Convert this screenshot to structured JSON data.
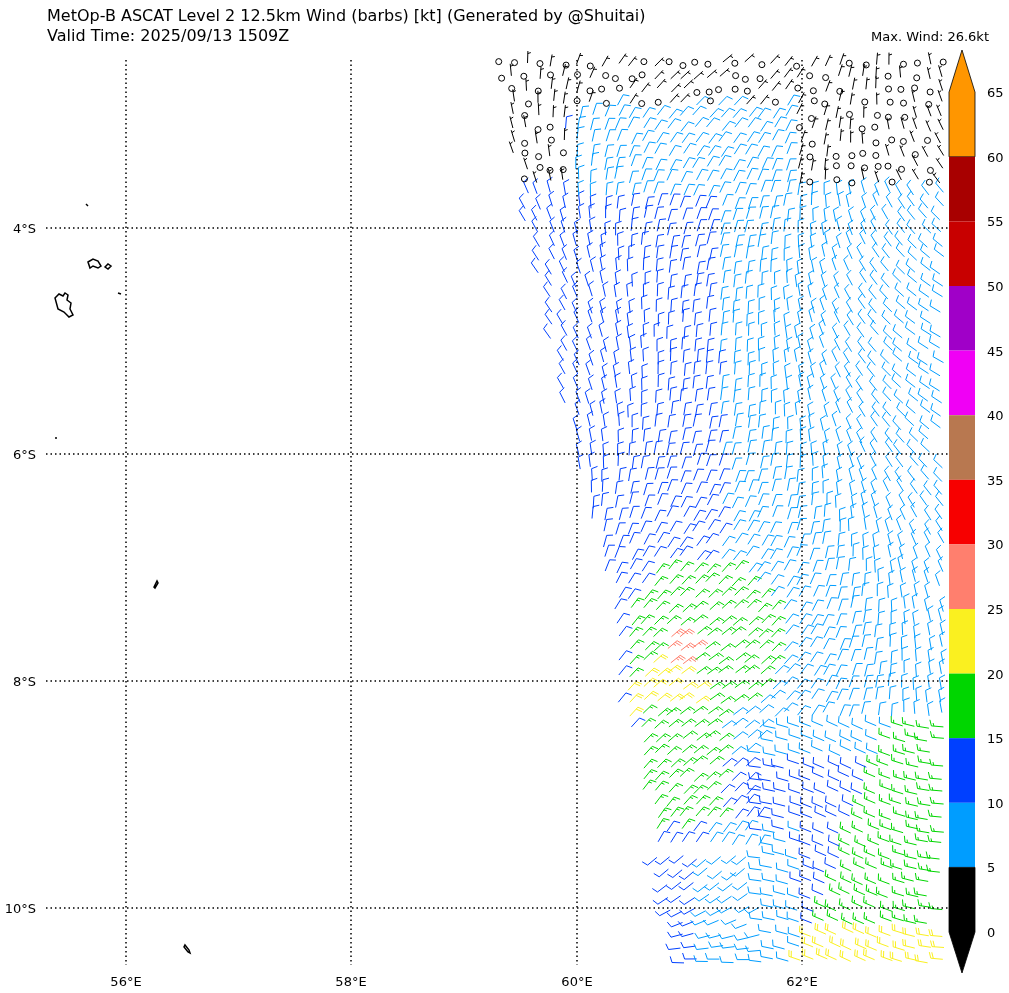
{
  "title": "MetOp-B ASCAT Level 2 12.5km Wind (barbs) [kt] (Generated by @Shuitai)",
  "subtitle": "Valid Time: 2025/09/13 1509Z",
  "max_wind": "Max. Wind: 26.6kt",
  "map": {
    "lat_labels": [
      "4°S",
      "6°S",
      "8°S",
      "10°S"
    ],
    "lon_labels": [
      "56°E",
      "58°E",
      "60°E",
      "62°E"
    ]
  },
  "colorbar": {
    "ticks": [
      "65",
      "60",
      "55",
      "50",
      "45",
      "40",
      "35",
      "30",
      "25",
      "20",
      "15",
      "10",
      "5",
      "0"
    ],
    "bins": [
      {
        "color": "#ff9600"
      },
      {
        "color": "#a80000"
      },
      {
        "color": "#c80000"
      },
      {
        "color": "#a000c8"
      },
      {
        "color": "#f000f5"
      },
      {
        "color": "#b87850"
      },
      {
        "color": "#f70000"
      },
      {
        "color": "#ff7f6e"
      },
      {
        "color": "#faf020"
      },
      {
        "color": "#00d600"
      },
      {
        "color": "#0040ff"
      },
      {
        "color": "#009dff"
      },
      {
        "color": "#000000"
      }
    ]
  }
}
